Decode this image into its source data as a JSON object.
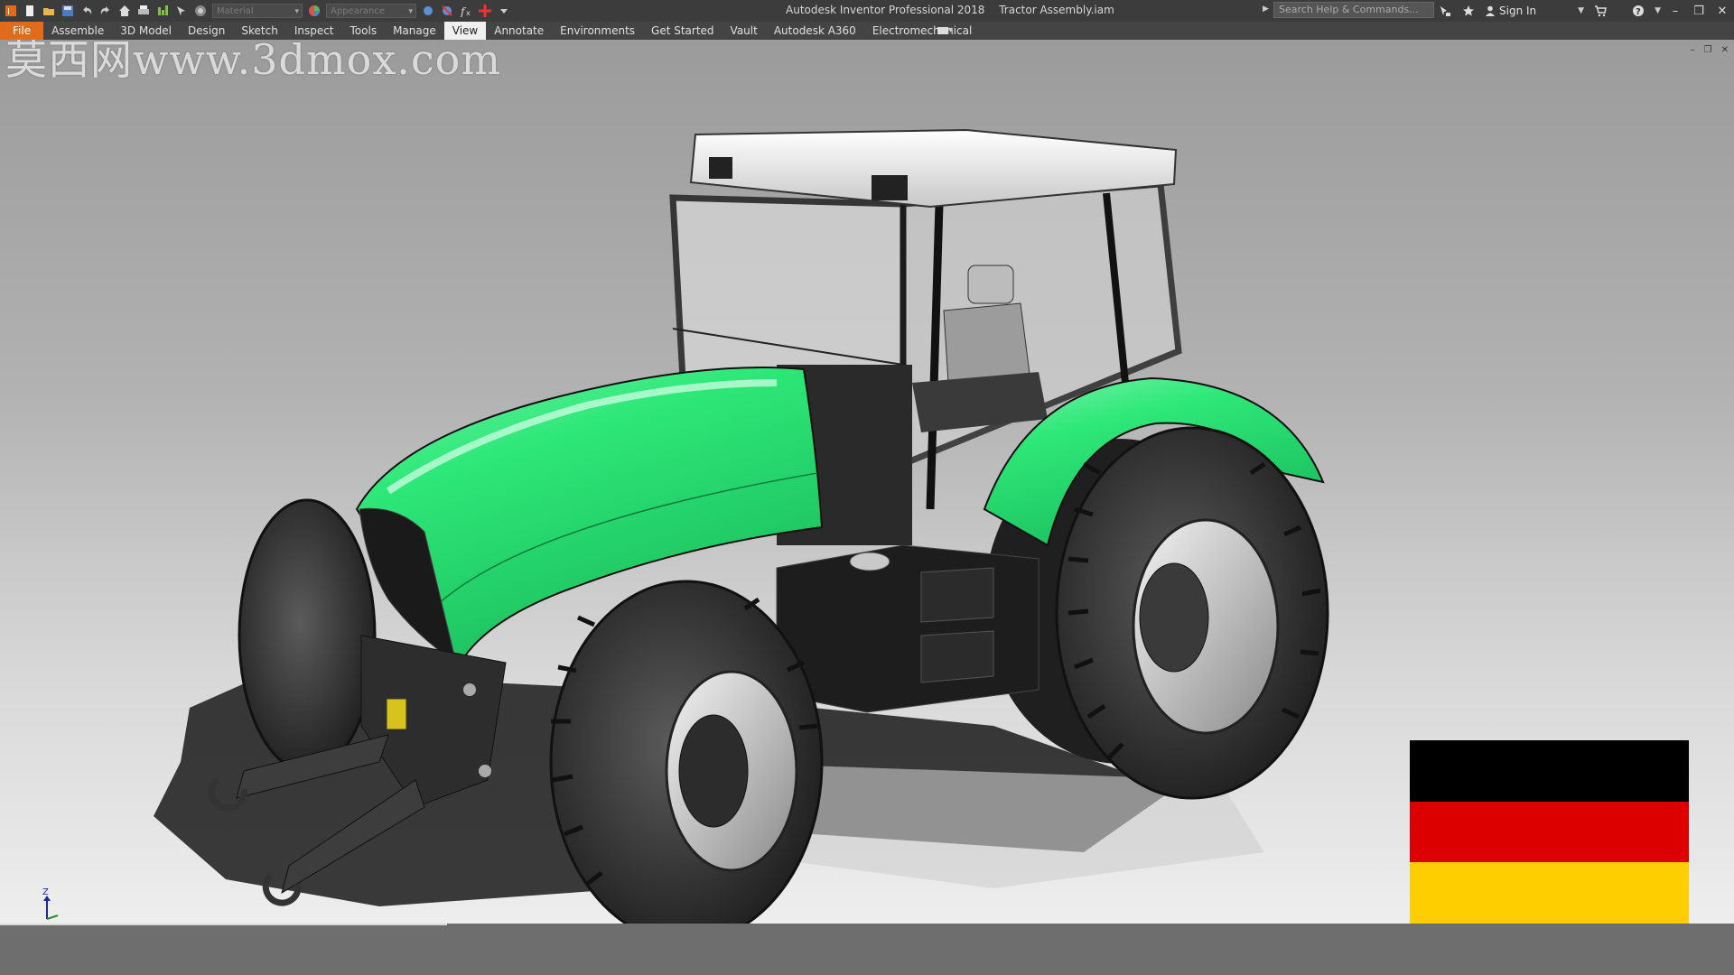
{
  "titlebar": {
    "app_title": "Autodesk Inventor Professional 2018",
    "document_title": "Tractor Assembly.iam",
    "material_select": "Material",
    "appearance_select": "Appearance",
    "search_placeholder": "Search Help & Commands...",
    "sign_in": "Sign In"
  },
  "ribbon": {
    "tabs": [
      "File",
      "Assemble",
      "3D Model",
      "Design",
      "Sketch",
      "Inspect",
      "Tools",
      "Manage",
      "View",
      "Annotate",
      "Environments",
      "Get Started",
      "Vault",
      "Autodesk A360",
      "Electromechanical"
    ],
    "active_tab": "View"
  },
  "viewport": {
    "watermark": "莫西网www.3dmox.com",
    "triad_axis_label": "Z",
    "flag_colors": [
      "#000000",
      "#dd0000",
      "#ffce00"
    ]
  },
  "colors": {
    "body_green": "#2ee879",
    "accent_orange": "#e06b1a"
  }
}
